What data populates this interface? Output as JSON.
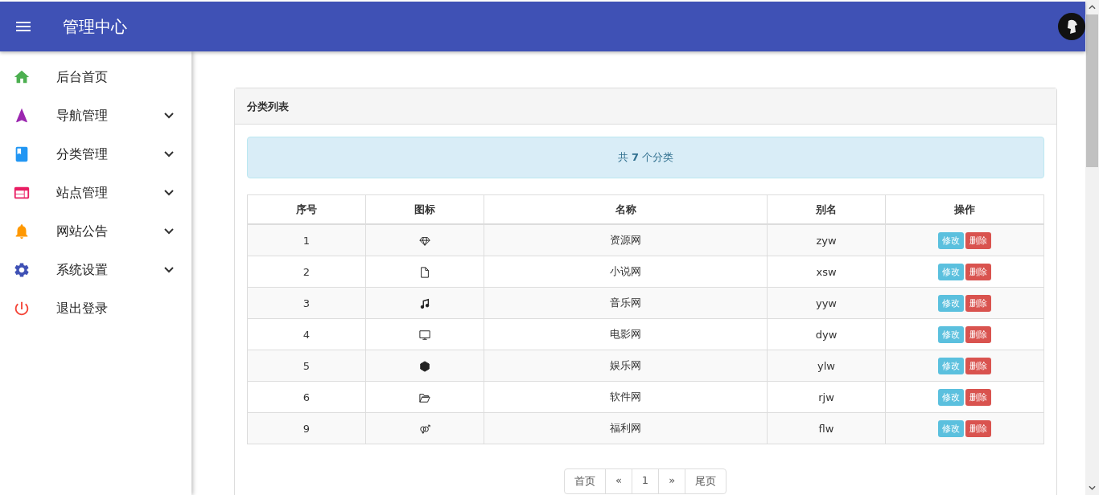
{
  "header": {
    "title": "管理中心"
  },
  "sidebar": {
    "items": [
      {
        "label": "后台首页",
        "color": "#4caf50",
        "expandable": false
      },
      {
        "label": "导航管理",
        "color": "#9c27b0",
        "expandable": true
      },
      {
        "label": "分类管理",
        "color": "#2196f3",
        "expandable": true
      },
      {
        "label": "站点管理",
        "color": "#e91e63",
        "expandable": true
      },
      {
        "label": "网站公告",
        "color": "#ff9800",
        "expandable": true
      },
      {
        "label": "系统设置",
        "color": "#3f51b5",
        "expandable": true
      },
      {
        "label": "退出登录",
        "color": "#f44336",
        "expandable": false
      }
    ]
  },
  "panel": {
    "title": "分类列表",
    "alert": "共 **7** 个分类",
    "table": {
      "columns": [
        "序号",
        "图标",
        "名称",
        "别名",
        "操作"
      ],
      "rows": [
        {
          "id": "1",
          "name": "资源网",
          "alias": "zyw",
          "actions": [
            {
              "label": "修改",
              "kind": "edit"
            },
            {
              "label": "删除",
              "kind": "delete"
            }
          ]
        },
        {
          "id": "2",
          "name": "小说网",
          "alias": "xsw",
          "actions": [
            {
              "label": "修改",
              "kind": "edit"
            },
            {
              "label": "删除",
              "kind": "delete"
            }
          ]
        },
        {
          "id": "3",
          "name": "音乐网",
          "alias": "yyw",
          "actions": [
            {
              "label": "修改",
              "kind": "edit"
            },
            {
              "label": "删除",
              "kind": "delete"
            }
          ]
        },
        {
          "id": "4",
          "name": "电影网",
          "alias": "dyw",
          "actions": [
            {
              "label": "修改",
              "kind": "edit"
            },
            {
              "label": "删除",
              "kind": "delete"
            }
          ]
        },
        {
          "id": "5",
          "name": "娱乐网",
          "alias": "ylw",
          "actions": [
            {
              "label": "修改",
              "kind": "edit"
            },
            {
              "label": "删除",
              "kind": "delete"
            }
          ]
        },
        {
          "id": "6",
          "name": "软件网",
          "alias": "rjw",
          "actions": [
            {
              "label": "修改",
              "kind": "edit"
            },
            {
              "label": "删除",
              "kind": "delete"
            }
          ]
        },
        {
          "id": "9",
          "name": "福利网",
          "alias": "flw",
          "actions": [
            {
              "label": "修改",
              "kind": "edit"
            },
            {
              "label": "删除",
              "kind": "delete"
            }
          ]
        }
      ]
    },
    "pagination": [
      "首页",
      "«",
      "1",
      "»",
      "尾页"
    ]
  }
}
